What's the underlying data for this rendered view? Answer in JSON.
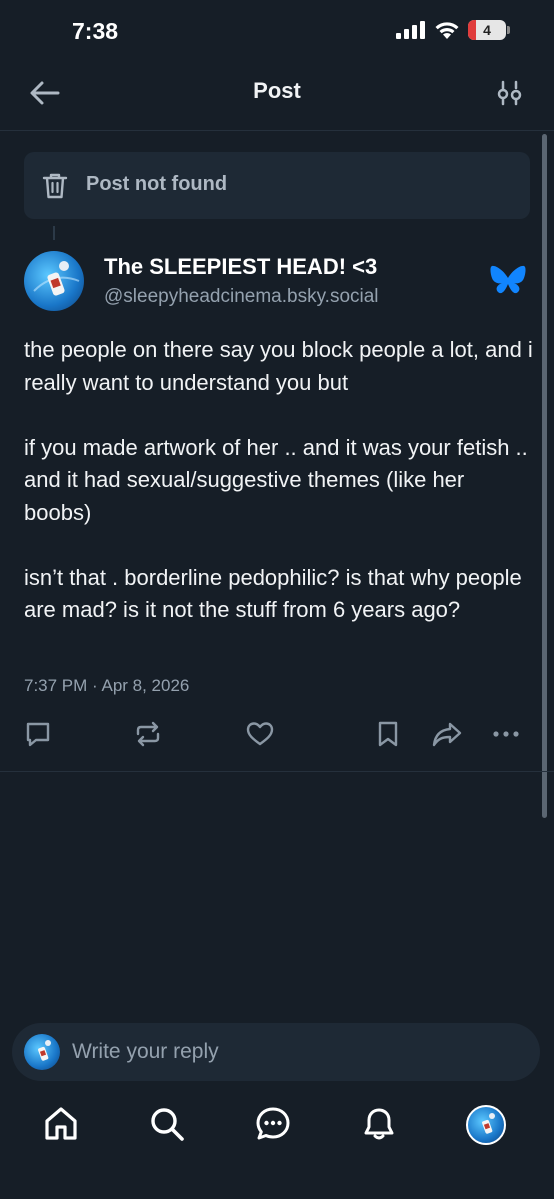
{
  "status_bar": {
    "time": "7:38",
    "battery": "4"
  },
  "header": {
    "title": "Post"
  },
  "notice": {
    "text": "Post not found"
  },
  "post": {
    "author_name": "The SLEEPIEST HEAD! <3",
    "author_handle": "@sleepyheadcinema.bsky.social",
    "paragraphs": [
      "the people on there say you block people a lot, and i really want to understand you but",
      "if you made artwork of her .. and it was your fetish .. and it had sexual/suggestive themes (like her boobs)",
      "isn’t that . borderline pedophilic? is that why people are mad? is it not the stuff from 6 years ago?"
    ],
    "timestamp": "7:37 PM · Apr 8, 2026"
  },
  "reply": {
    "placeholder": "Write your reply"
  },
  "colors": {
    "background": "#161e27",
    "surface": "#1e2935",
    "muted": "#94a1ae",
    "bluesky": "#1185fe"
  },
  "icons": {
    "header": [
      "back-arrow-icon",
      "tune-icon"
    ],
    "actions": [
      "reply-icon",
      "repost-icon",
      "like-icon",
      "bookmark-icon",
      "share-icon",
      "more-icon"
    ],
    "nav": [
      "home-icon",
      "search-icon",
      "chat-icon",
      "notifications-icon",
      "profile-avatar"
    ]
  }
}
